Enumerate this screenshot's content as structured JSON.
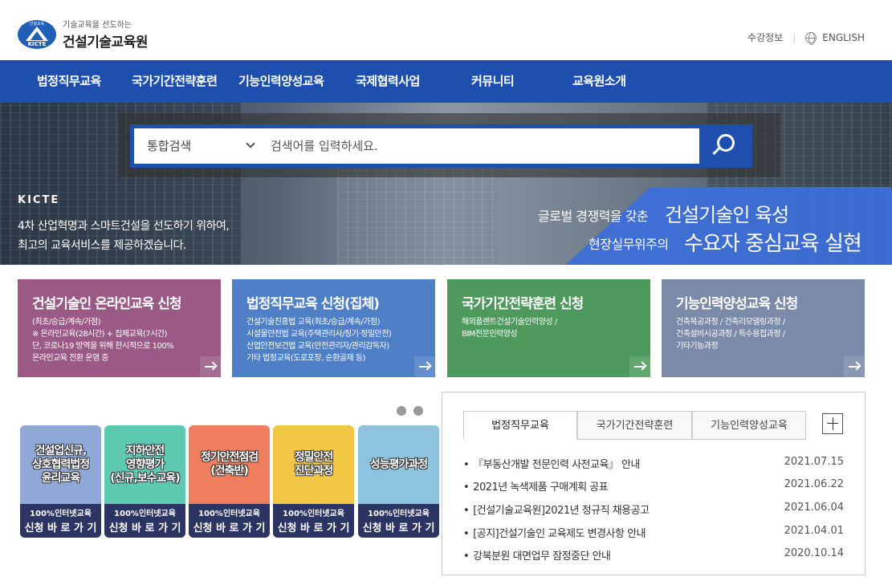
{
  "header": {
    "logo_sub": "기술교육을 선도하는",
    "logo_main": "건설기술교육원",
    "logo_mark_top": "건설교육",
    "logo_mark_bottom": "KICTE",
    "util_course": "수강정보",
    "util_sep": "|",
    "util_english": "ENGLISH"
  },
  "nav": [
    {
      "label": "법정직무교육"
    },
    {
      "label": "국가기간전략훈련"
    },
    {
      "label": "기능인력양성교육"
    },
    {
      "label": "국제협력사업"
    },
    {
      "label": "커뮤니티"
    },
    {
      "label": "교육원소개"
    }
  ],
  "search": {
    "select_value": "통합검색",
    "placeholder": "검색어를 입력하세요."
  },
  "hero": {
    "brand": "KICTE",
    "line1": "4차 산업혁명과 스마트건설을 선도하기 위하여,",
    "line2": "최고의 교육서비스를 제공하겠습니다.",
    "r1a": "글로벌 경쟁력을 갖춘",
    "r1b": "건설기술인 육성",
    "r2a": "현장실무위주의",
    "r2b": "수요자 중심교육 실현"
  },
  "cards": [
    {
      "title": "건설기술인 온라인교육 신청",
      "desc": "(최초/승급/계속/가점)\n※ 온라인교육(28시간) + 집체교육(7시간)\n    단, 코로나19 방역을 위해 한시적으로 100%\n    온라인교육 전환 운영 중",
      "color": "#9b5a86"
    },
    {
      "title": "법정직무교육 신청(집체)",
      "desc": "건설기술진흥법 교육(최초/승급/계속/가점)\n시설물안전법 교육(주택관리사/정기·정밀안전)\n산업안전보건법 교육(안전관리자/관리감독자)\n기타 법정교육(도로포장, 순환골재 등)",
      "color": "#4f7fc6"
    },
    {
      "title": "국가기간전략훈련 신청",
      "desc": "해외플랜트건설기술인력양성 /\nBIM전문인력양성",
      "color": "#4e9a5c"
    },
    {
      "title": "기능인력양성교육 신청",
      "desc": "건축목공과정 / 건축리모델링과정 /\n건축설비시공과정 / 특수용접과정 /\n기타기능과정",
      "color": "#7a8aa8"
    }
  ],
  "quick": [
    {
      "title": "건설업신규,\n상호협력법정\n윤리교육",
      "sub": "100%인터넷교육",
      "link": "신청 바 로 가 기",
      "color": "#8fa8d8"
    },
    {
      "title": "지하안전\n영향평가\n(신규,보수교육)",
      "sub": "100%인터넷교육",
      "link": "신청 바 로 가 기",
      "color": "#5cc9b0"
    },
    {
      "title": "정기안전점검\n(건축반)",
      "sub": "100%인터넷교육",
      "link": "신청 바 로 가 기",
      "color": "#ef7e5e"
    },
    {
      "title": "정밀안전\n진단과정",
      "sub": "100%인터넷교육",
      "link": "신청 바 로 가 기",
      "color": "#f2c744"
    },
    {
      "title": "성능평가과정",
      "sub": "100%인터넷교육",
      "link": "신청 바 로 가 기",
      "color": "#8ec3e0"
    }
  ],
  "notice": {
    "tabs": [
      {
        "label": "법정직무교육"
      },
      {
        "label": "국가기간전략훈련"
      },
      {
        "label": "기능인력양성교육"
      }
    ],
    "items": [
      {
        "title": "『부동산개발 전문인력 사전교육』 안내",
        "date": "2021.07.15"
      },
      {
        "title": "2021년 녹색제품 구매계획 공표",
        "date": "2021.06.22"
      },
      {
        "title": "[건설기술교육원]2021년 정규직 채용공고",
        "date": "2021.06.04"
      },
      {
        "title": "[공지]건설기술인 교육제도 변경사항 안내",
        "date": "2021.04.01"
      },
      {
        "title": "강북분원 대면업무 잠정중단 안내",
        "date": "2020.10.14"
      }
    ]
  }
}
